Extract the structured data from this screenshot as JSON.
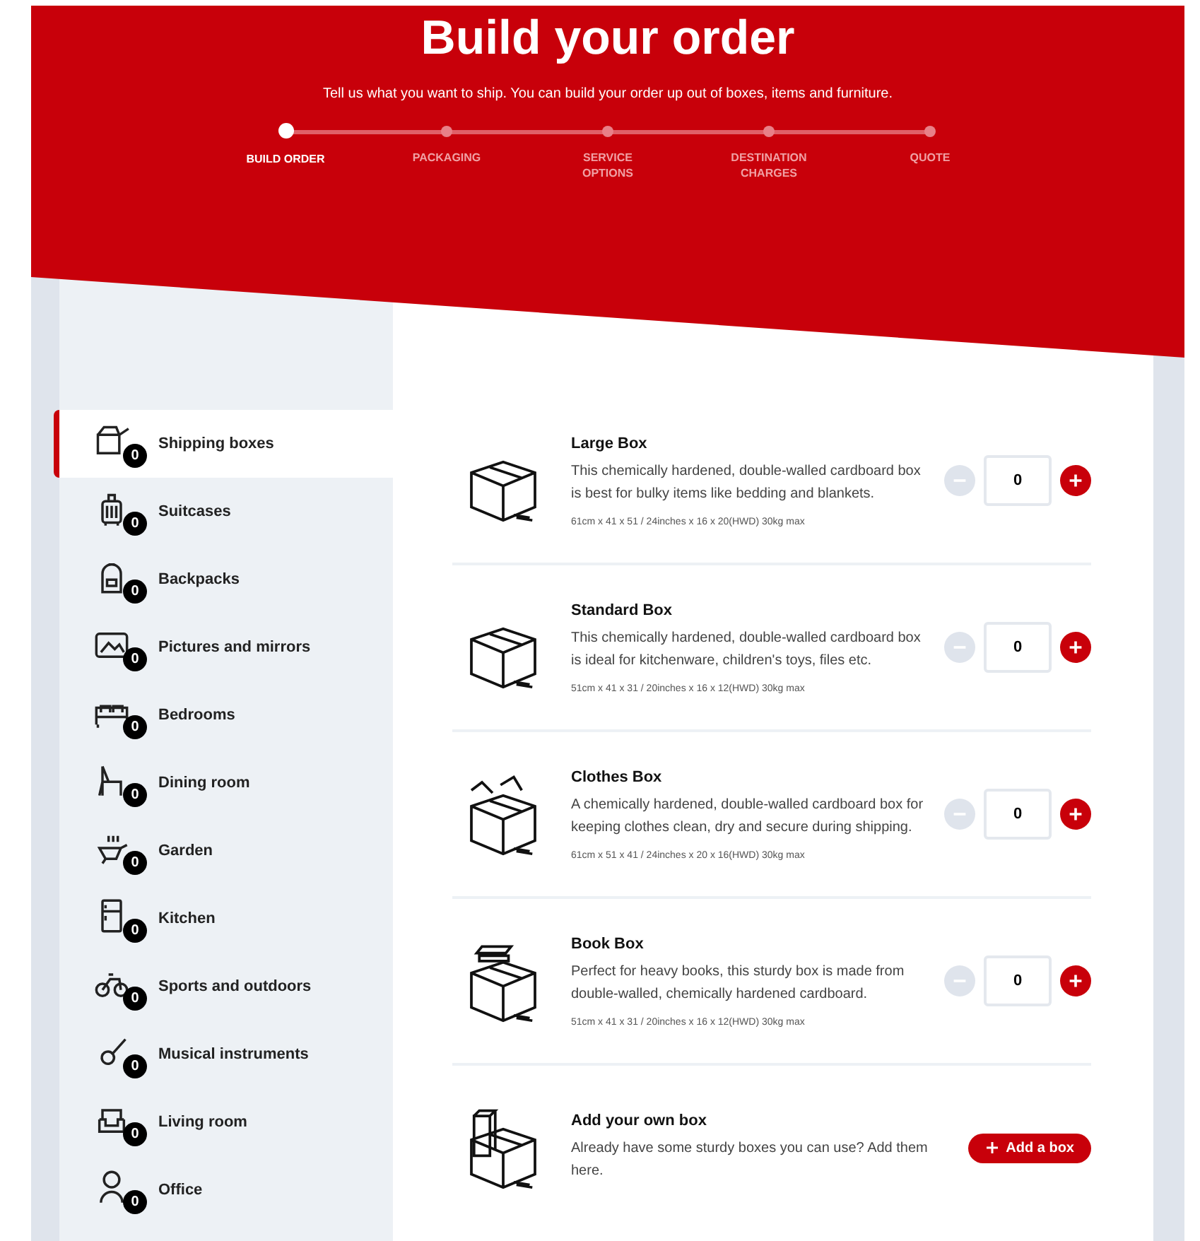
{
  "header": {
    "title": "Build your order",
    "subtitle": "Tell us what you want to ship. You can build your order up out of boxes, items and furniture."
  },
  "steps": [
    {
      "label": "BUILD ORDER",
      "selected": true
    },
    {
      "label": "PACKAGING",
      "selected": false
    },
    {
      "label": "SERVICE OPTIONS",
      "selected": false
    },
    {
      "label": "DESTINATION CHARGES",
      "selected": false
    },
    {
      "label": "QUOTE",
      "selected": false
    }
  ],
  "sidebar": {
    "items": [
      {
        "label": "Shipping boxes",
        "count": "0",
        "selected": true
      },
      {
        "label": "Suitcases",
        "count": "0",
        "selected": false
      },
      {
        "label": "Backpacks",
        "count": "0",
        "selected": false
      },
      {
        "label": "Pictures and mirrors",
        "count": "0",
        "selected": false
      },
      {
        "label": "Bedrooms",
        "count": "0",
        "selected": false
      },
      {
        "label": "Dining room",
        "count": "0",
        "selected": false
      },
      {
        "label": "Garden",
        "count": "0",
        "selected": false
      },
      {
        "label": "Kitchen",
        "count": "0",
        "selected": false
      },
      {
        "label": "Sports and outdoors",
        "count": "0",
        "selected": false
      },
      {
        "label": "Musical instruments",
        "count": "0",
        "selected": false
      },
      {
        "label": "Living room",
        "count": "0",
        "selected": false
      },
      {
        "label": "Office",
        "count": "0",
        "selected": false
      }
    ]
  },
  "products": [
    {
      "kind": "product",
      "title": "Large Box",
      "description": "This chemically hardened, double-walled cardboard box is best for bulky items like bedding and blankets.",
      "dimensions": "61cm x 41 x 51 / 24inches x 16 x 20(HWD) 30kg max",
      "quantity": "0",
      "decrease_disabled": true
    },
    {
      "kind": "product",
      "title": "Standard Box",
      "description": "This chemically hardened, double-walled cardboard box is ideal for kitchenware, children's toys, files etc.",
      "dimensions": "51cm x 41 x 31 / 20inches x 16 x 12(HWD) 30kg max",
      "quantity": "0",
      "decrease_disabled": true
    },
    {
      "kind": "product",
      "title": "Clothes Box",
      "description": "A chemically hardened, double-walled cardboard box for keeping clothes clean, dry and secure during shipping.",
      "dimensions": "61cm x 51 x 41 / 24inches x 20 x 16(HWD) 30kg max",
      "quantity": "0",
      "decrease_disabled": true
    },
    {
      "kind": "product",
      "title": "Book Box",
      "description": "Perfect for heavy books, this sturdy box is made from double-walled, chemically hardened cardboard.",
      "dimensions": "51cm x 41 x 31 / 20inches x 16 x 12(HWD) 30kg max",
      "quantity": "0",
      "decrease_disabled": true
    },
    {
      "kind": "custom",
      "title": "Add your own box",
      "description": "Already have some sturdy boxes you can use? Add them here.",
      "button": "Add a box"
    }
  ]
}
